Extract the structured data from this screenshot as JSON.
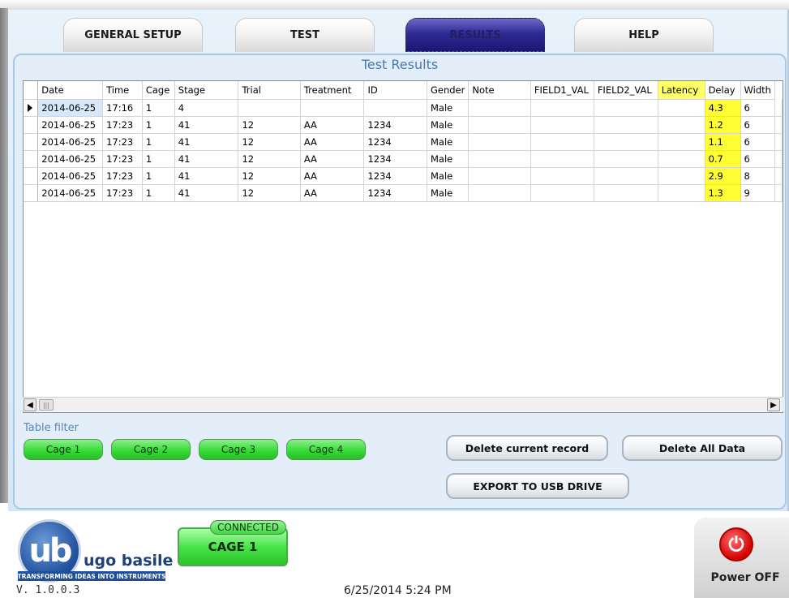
{
  "tabs": [
    {
      "label": "GENERAL SETUP",
      "active": false
    },
    {
      "label": "TEST",
      "active": false
    },
    {
      "label": "RESULTS",
      "active": true
    },
    {
      "label": "HELP",
      "active": false
    }
  ],
  "panel": {
    "title": "Test Results"
  },
  "table": {
    "columns": [
      "Date",
      "Time",
      "Cage",
      "Stage",
      "Trial",
      "Treatment",
      "ID",
      "Gender",
      "Note",
      "FIELD1_VAL",
      "FIELD2_VAL",
      "Latency",
      "Delay",
      "Width"
    ],
    "rows": [
      [
        "2014-06-25",
        "17:16",
        "1",
        "4",
        "",
        "",
        "",
        "Male",
        "",
        "",
        "",
        "",
        "4.3",
        "6"
      ],
      [
        "2014-06-25",
        "17:23",
        "1",
        "41",
        "12",
        "AA",
        "1234",
        "Male",
        "",
        "",
        "",
        "",
        "1.2",
        "6"
      ],
      [
        "2014-06-25",
        "17:23",
        "1",
        "41",
        "12",
        "AA",
        "1234",
        "Male",
        "",
        "",
        "",
        "",
        "1.1",
        "6"
      ],
      [
        "2014-06-25",
        "17:23",
        "1",
        "41",
        "12",
        "AA",
        "1234",
        "Male",
        "",
        "",
        "",
        "",
        "0.7",
        "6"
      ],
      [
        "2014-06-25",
        "17:23",
        "1",
        "41",
        "12",
        "AA",
        "1234",
        "Male",
        "",
        "",
        "",
        "",
        "2.9",
        "8"
      ],
      [
        "2014-06-25",
        "17:23",
        "1",
        "41",
        "12",
        "AA",
        "1234",
        "Male",
        "",
        "",
        "",
        "",
        "1.3",
        "9"
      ]
    ],
    "highlight_color": "#ffff33"
  },
  "filter": {
    "label": "Table filter",
    "buttons": [
      "Cage 1",
      "Cage 2",
      "Cage 3",
      "Cage 4"
    ]
  },
  "actions": {
    "delete_current": "Delete current record",
    "delete_all": "Delete All Data",
    "export": "EXPORT TO USB DRIVE"
  },
  "footer": {
    "logo_mark": "ub",
    "logo_name": "ugo basile",
    "logo_tagline": "TRANSFORMING IDEAS INTO INSTRUMENTS",
    "version": "V. 1.0.0.3",
    "datetime": "6/25/2014 5:24 PM",
    "connection_status": "CONNECTED",
    "cage_label": "CAGE 1",
    "power_label": "Power OFF",
    "power_icon": "power-icon"
  },
  "scrollbar": {
    "left_arrow": "◀",
    "right_arrow": "▶",
    "thumb_grip": "|||"
  }
}
